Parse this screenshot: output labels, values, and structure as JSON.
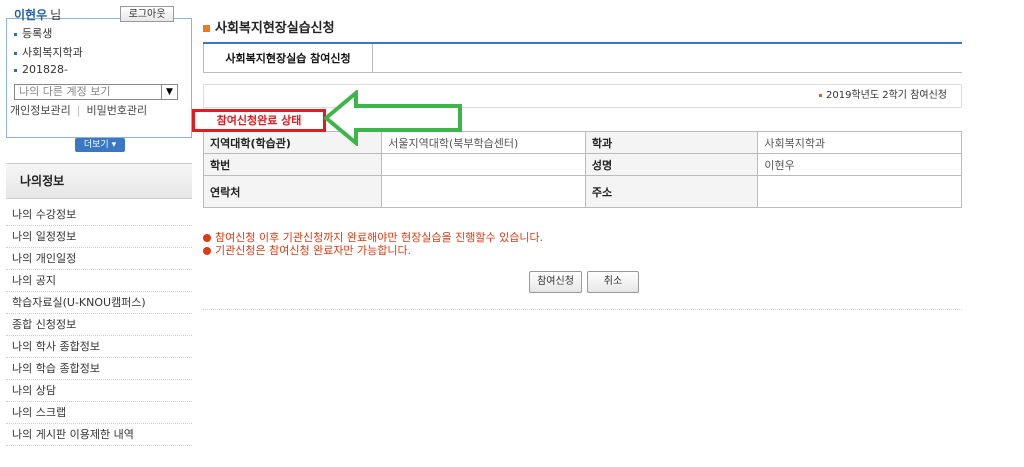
{
  "user": {
    "name": "이현우",
    "suffix": "님",
    "logout_label": "로그아웃",
    "status": "등록생",
    "department": "사회복지학과",
    "student_id": "201828-",
    "account_select": "나의 다른 계정 보기",
    "profile_link": "개인정보관리",
    "password_link": "비밀번호관리",
    "more_label": "더보기"
  },
  "sidebar": {
    "header": "나의정보",
    "items": [
      "나의 수강정보",
      "나의 일정정보",
      "나의 개인일정",
      "나의 공지",
      "학습자료실(U-KNOU캠퍼스)",
      "종합 신청정보",
      "나의 학사 종합정보",
      "나의 학습 종합정보",
      "나의 상담",
      "나의 스크랩",
      "나의 게시판 이용제한 내역"
    ]
  },
  "main": {
    "title": "사회복지현장실습신청",
    "tab_label": "사회복지현장실습 참여신청",
    "semester": "2019학년도 2학기 참여신청",
    "table": {
      "rows": [
        {
          "h1": "지역대학(학습관)",
          "v1": "서울지역대학(북부학습센터)",
          "h2": "학과",
          "v2": "사회복지학과"
        },
        {
          "h1": "학번",
          "v1": "",
          "h2": "성명",
          "v2": "이현우"
        },
        {
          "h1": "연락처",
          "v1": "",
          "h2": "주소",
          "v2": ""
        }
      ]
    },
    "notices": [
      "참여신청 이후 기관신청까지 완료해야만 현장실습을 진행할수 있습니다.",
      "기관신청은 참여신청 완료자만 가능합니다."
    ],
    "apply_label": "참여신청",
    "cancel_label": "취소"
  },
  "annotation": {
    "label": "참여신청완료 상태",
    "box_color": "#e8191e",
    "arrow_color": "#3db54a"
  }
}
